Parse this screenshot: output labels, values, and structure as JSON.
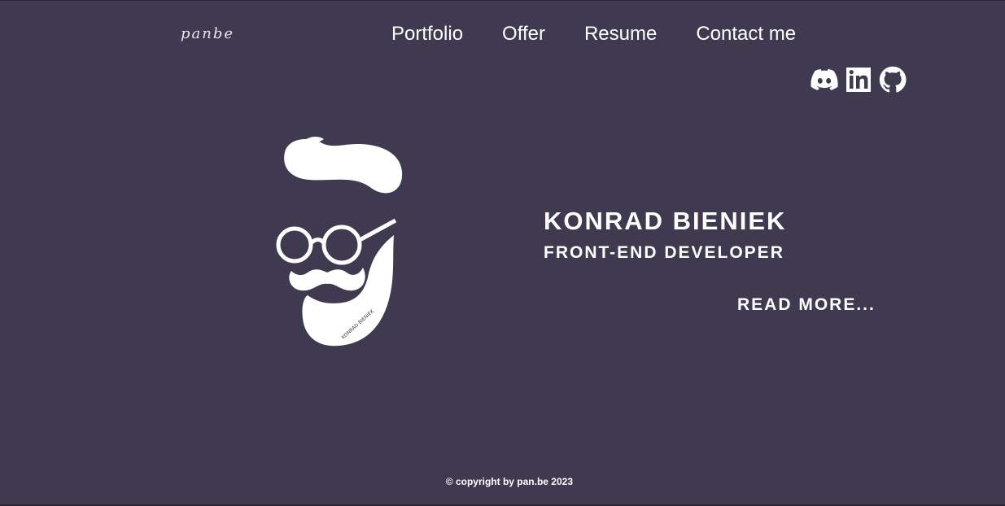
{
  "header": {
    "logo": "panbe",
    "nav": [
      {
        "label": "Portfolio"
      },
      {
        "label": "Offer"
      },
      {
        "label": "Resume"
      },
      {
        "label": "Contact me"
      }
    ]
  },
  "socials": [
    {
      "icon": "discord-icon"
    },
    {
      "icon": "linkedin-icon"
    },
    {
      "icon": "github-icon"
    }
  ],
  "hero": {
    "avatar_caption": "KONRAD BIENIEK",
    "name": "KONRAD BIENIEK",
    "role": "FRONT-END DEVELOPER",
    "read_more": "READ MORE..."
  },
  "footer": {
    "copyright": "© copyright by pan.be 2023"
  },
  "colors": {
    "background": "#3f3a4f",
    "text": "#ffffff"
  }
}
